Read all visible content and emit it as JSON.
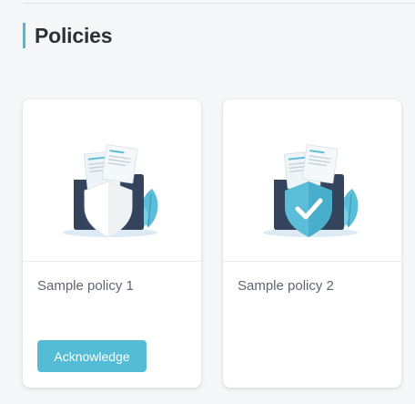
{
  "page": {
    "title": "Policies"
  },
  "colors": {
    "accent": "#55bcd6",
    "folder": "#34445c",
    "shield_teal": "#5bbdd8"
  },
  "policies": [
    {
      "title": "Sample policy 1",
      "icon": "folder-shield-icon",
      "action_label": "Acknowledge"
    },
    {
      "title": "Sample policy 2",
      "icon": "folder-shield-check-icon"
    }
  ]
}
